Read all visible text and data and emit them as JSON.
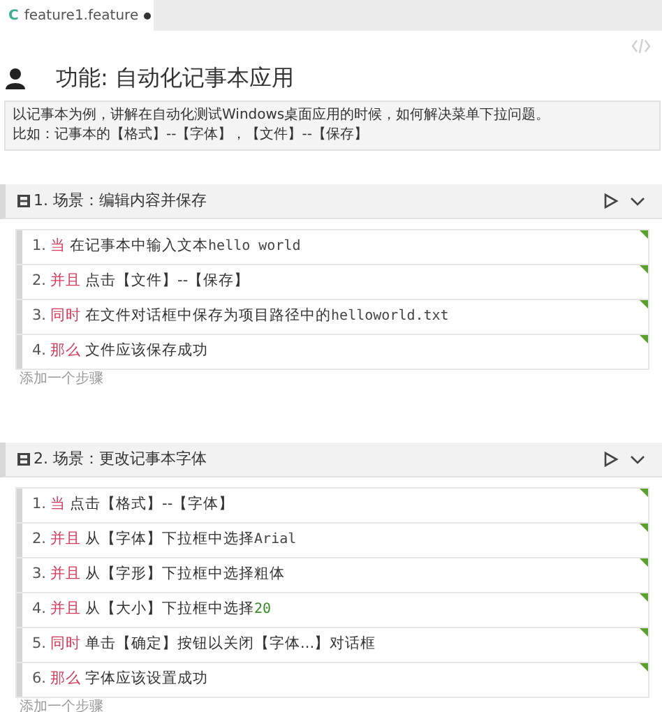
{
  "tab": {
    "icon": "C",
    "title": "feature1.feature",
    "modified": true
  },
  "feature": {
    "title": "功能: 自动化记事本应用",
    "description": [
      "以记事本为例，讲解在自动化测试Windows桌面应用的时候，如何解决菜单下拉问题。",
      "比如：记事本的【格式】--【字体】，【文件】--【保存】"
    ]
  },
  "scenarios": [
    {
      "title": "1. 场景：编辑内容并保存",
      "add_step": "添加一个步骤",
      "steps": [
        {
          "number": "1.",
          "keyword": "当",
          "parts": [
            {
              "kind": "text",
              "text": "在记事本中输入文本"
            },
            {
              "kind": "code",
              "text": "hello world"
            }
          ]
        },
        {
          "number": "2.",
          "keyword": "并且",
          "parts": [
            {
              "kind": "text",
              "text": "点击【文件】--【保存】"
            }
          ]
        },
        {
          "number": "3.",
          "keyword": "同时",
          "parts": [
            {
              "kind": "text",
              "text": "在文件对话框中保存为项目路径中的"
            },
            {
              "kind": "code",
              "text": "helloworld.txt"
            }
          ]
        },
        {
          "number": "4.",
          "keyword": "那么",
          "parts": [
            {
              "kind": "text",
              "text": "文件应该保存成功"
            }
          ]
        }
      ]
    },
    {
      "title": "2. 场景：更改记事本字体",
      "add_step": "添加一个步骤",
      "steps": [
        {
          "number": "1.",
          "keyword": "当",
          "parts": [
            {
              "kind": "text",
              "text": "点击【格式】--【字体】"
            }
          ]
        },
        {
          "number": "2.",
          "keyword": "并且",
          "parts": [
            {
              "kind": "text",
              "text": "从【字体】下拉框中选择"
            },
            {
              "kind": "code",
              "text": "Arial"
            }
          ]
        },
        {
          "number": "3.",
          "keyword": "并且",
          "parts": [
            {
              "kind": "text",
              "text": "从【字形】下拉框中选择粗体"
            }
          ]
        },
        {
          "number": "4.",
          "keyword": "并且",
          "parts": [
            {
              "kind": "text",
              "text": "从【大小】下拉框中选择"
            },
            {
              "kind": "number",
              "text": "20"
            }
          ]
        },
        {
          "number": "5.",
          "keyword": "同时",
          "parts": [
            {
              "kind": "text",
              "text": "单击【确定】按钮以关闭【字体...】对话框"
            }
          ]
        },
        {
          "number": "6.",
          "keyword": "那么",
          "parts": [
            {
              "kind": "text",
              "text": "字体应该设置成功"
            }
          ]
        }
      ]
    }
  ]
}
